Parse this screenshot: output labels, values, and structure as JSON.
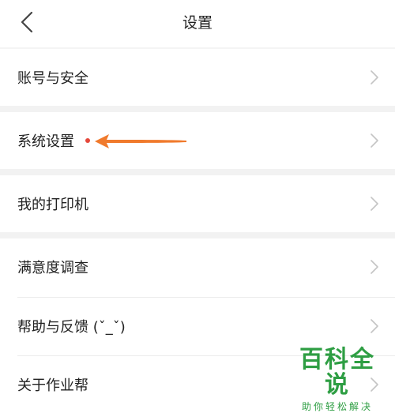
{
  "header": {
    "title": "设置"
  },
  "menu": {
    "account_security": "账号与安全",
    "system_settings": "系统设置",
    "my_printer": "我的打印机",
    "satisfaction_survey": "满意度调查",
    "help_feedback": "帮助与反馈 (ˇ_ˇ)",
    "about": "关于作业帮"
  },
  "watermark": {
    "title": "百科全说",
    "subtitle": "助你轻松解决"
  },
  "colors": {
    "accent_arrow": "#f07a2c",
    "red_dot": "#e5483b",
    "watermark_green": "#2e9e43",
    "section_gap": "#f2f2f2"
  },
  "icons": {
    "back": "chevron-left-icon",
    "row_arrow": "chevron-right-icon"
  }
}
